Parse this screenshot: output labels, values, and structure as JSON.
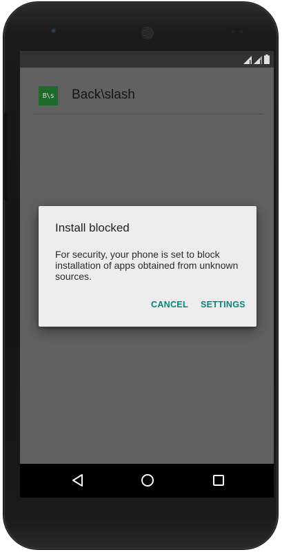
{
  "app": {
    "icon_text": "B\\s",
    "title": "Back\\slash"
  },
  "dialog": {
    "title": "Install blocked",
    "message": "For security, your phone is set to block installation of apps obtained from unknown sources.",
    "cancel_label": "CANCEL",
    "settings_label": "SETTINGS",
    "accent_color": "#00897b"
  },
  "status_bar": {
    "icons": [
      "signal-icon",
      "signal-icon",
      "battery-icon"
    ]
  },
  "nav_bar": {
    "buttons": [
      "back-icon",
      "home-icon",
      "recents-icon"
    ]
  },
  "colors": {
    "screen_dim": "#616161",
    "status_bar": "#333333",
    "dialog_bg": "#ececec",
    "app_icon_bg": "#1e6a2a"
  }
}
